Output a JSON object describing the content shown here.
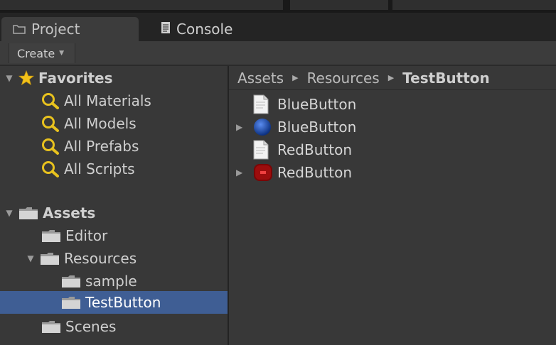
{
  "tabs": [
    {
      "label": "Project",
      "icon": "folder-icon",
      "active": true
    },
    {
      "label": "Console",
      "icon": "console-icon",
      "active": false
    }
  ],
  "toolbar": {
    "create_label": "Create"
  },
  "tree": {
    "favorites": {
      "label": "Favorites",
      "items": [
        "All Materials",
        "All Models",
        "All Prefabs",
        "All Scripts"
      ]
    },
    "assets": {
      "label": "Assets",
      "editor": "Editor",
      "resources": "Resources",
      "sample": "sample",
      "testbutton": "TestButton",
      "scenes": "Scenes"
    }
  },
  "breadcrumb": [
    "Assets",
    "Resources",
    "TestButton"
  ],
  "assets": [
    {
      "name": "BlueButton",
      "icon": "script-file-icon",
      "expandable": false
    },
    {
      "name": "BlueButton",
      "icon": "blue-prefab-icon",
      "expandable": true
    },
    {
      "name": "RedButton",
      "icon": "script-file-icon",
      "expandable": false
    },
    {
      "name": "RedButton",
      "icon": "red-prefab-icon",
      "expandable": true
    }
  ],
  "colors": {
    "selection": "#3f5e94",
    "background": "#383838",
    "star": "#f3c21a",
    "search": "#e8c21e"
  }
}
